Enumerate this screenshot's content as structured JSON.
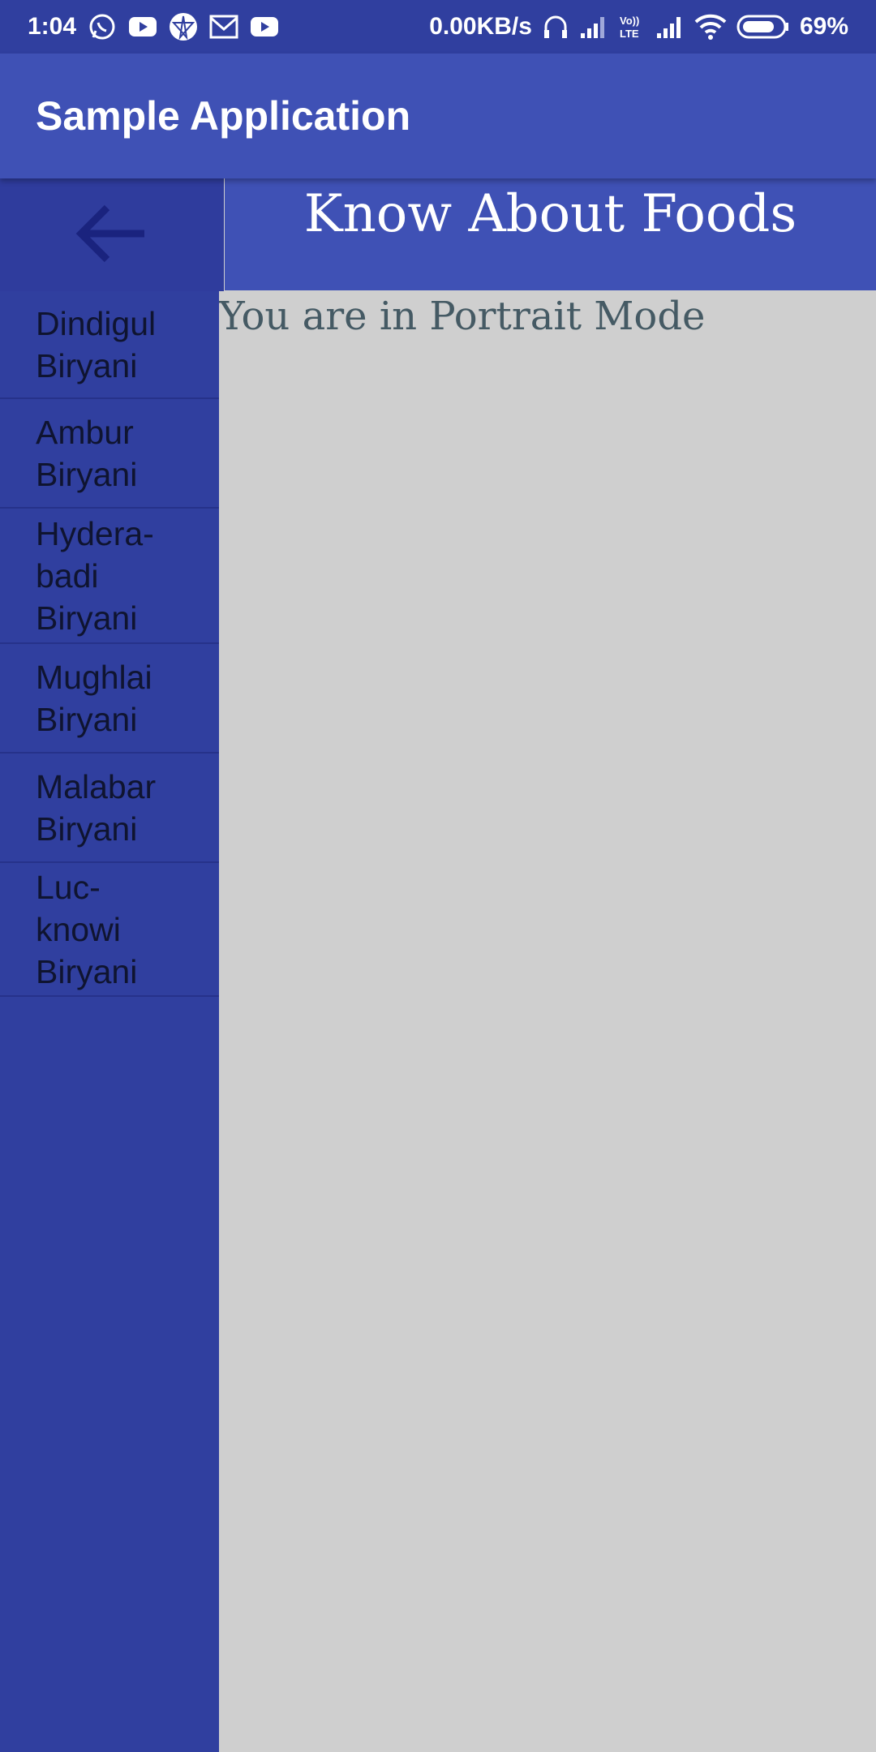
{
  "status_bar": {
    "time": "1:04",
    "net_speed": "0.00KB/s",
    "battery": "69%",
    "volte": "Vo)\nLTE",
    "icons_left": [
      "whatsapp-icon",
      "youtube-icon",
      "app-icon",
      "gmail-icon",
      "youtube-icon"
    ],
    "icons_right": [
      "headset-icon",
      "signal-icon",
      "volte-icon",
      "signal-icon",
      "wifi-icon",
      "battery-icon"
    ]
  },
  "app_bar": {
    "title": "Sample Application"
  },
  "sidebar": {
    "back_icon": "arrow-back-icon",
    "items": [
      {
        "label_lines": [
          "Dindigul",
          "Biryani"
        ]
      },
      {
        "label_lines": [
          "Ambur",
          "Biryani"
        ]
      },
      {
        "label_lines": [
          "Hydera-",
          "badi",
          "Biryani"
        ]
      },
      {
        "label_lines": [
          "Mughlai",
          "Biryani"
        ]
      },
      {
        "label_lines": [
          "Malabar",
          "Biryani"
        ]
      },
      {
        "label_lines": [
          "Luc-",
          "knowi",
          "Biryani"
        ]
      }
    ]
  },
  "content": {
    "header": "Know About Foods",
    "mode_text": "You are in Portrait Mode"
  },
  "colors": {
    "status_bar": "#303f9f",
    "app_bar": "#3f51b5",
    "sidebar": "#303f9f",
    "content_bg": "#cfcfcf",
    "mode_text": "#455a64"
  }
}
